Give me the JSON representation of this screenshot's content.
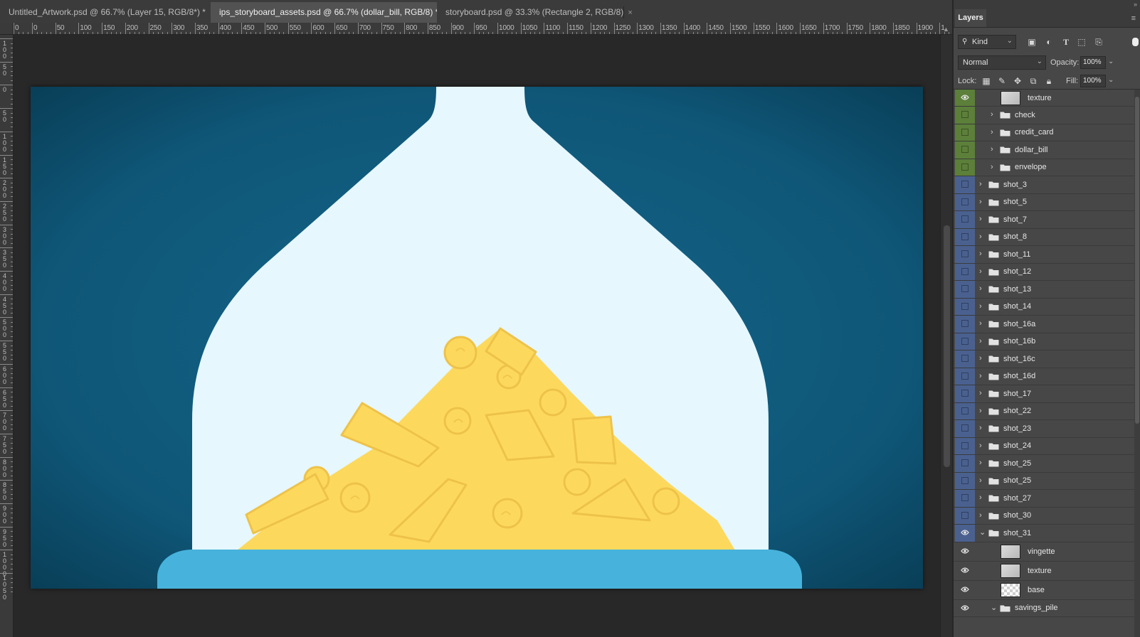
{
  "tabs": [
    {
      "label": "Untitled_Artwork.psd @ 66.7% (Layer 15, RGB/8*) *",
      "close": "×",
      "active": false
    },
    {
      "label": "ips_storyboard_assets.psd @ 66.7% (dollar_bill, RGB/8) *",
      "close": "×",
      "active": true
    },
    {
      "label": "storyboard.psd @ 33.3% (Rectangle 2, RGB/8)",
      "close": "×",
      "active": false
    }
  ],
  "ruler": {
    "h_labels": [
      "0",
      "0",
      "50",
      "100",
      "150",
      "200",
      "250",
      "300",
      "350",
      "400",
      "450",
      "500",
      "550",
      "600",
      "650",
      "700",
      "750",
      "800",
      "850",
      "900",
      "950",
      "1000",
      "1050",
      "1100",
      "1150",
      "1200",
      "1250",
      "1300",
      "1350",
      "1400",
      "1450",
      "1500",
      "1550",
      "1600",
      "1650",
      "1700",
      "1750",
      "1800",
      "1850",
      "1900",
      "1"
    ],
    "v_labels": [
      "100",
      "50",
      "0",
      "50",
      "100",
      "150",
      "200",
      "250",
      "300",
      "350",
      "400",
      "450",
      "500",
      "550",
      "600",
      "650",
      "700",
      "750",
      "800",
      "850",
      "900",
      "950",
      "1000",
      "1050"
    ]
  },
  "colors": {
    "background_blue": "#0e5677",
    "bottle": "#e6f7fd",
    "coins": "#fcd95c",
    "coin_line": "#eec24a",
    "base": "#47b3dc",
    "green_tag": "#5c7f3a",
    "blue_tag": "#4a6190"
  },
  "panel": {
    "title": "Layers",
    "collapse": "»",
    "menu": "≡",
    "filter_kind": "Kind",
    "blend_mode": "Normal",
    "opacity_label": "Opacity:",
    "opacity_value": "100%",
    "lock_label": "Lock:",
    "fill_label": "Fill:",
    "fill_value": "100%"
  },
  "layers": [
    {
      "name": "texture",
      "kind": "pixel",
      "visible": true,
      "tag": "green",
      "indent": 1
    },
    {
      "name": "check",
      "kind": "group",
      "visible": false,
      "tag": "green",
      "indent": 1,
      "expanded": false
    },
    {
      "name": "credit_card",
      "kind": "group",
      "visible": false,
      "tag": "green",
      "indent": 1,
      "expanded": false
    },
    {
      "name": "dollar_bill",
      "kind": "group",
      "visible": false,
      "tag": "green",
      "indent": 1,
      "expanded": false
    },
    {
      "name": "envelope",
      "kind": "group",
      "visible": false,
      "tag": "green",
      "indent": 1,
      "expanded": false
    },
    {
      "name": "shot_3",
      "kind": "group",
      "visible": false,
      "tag": "blue",
      "indent": 0,
      "expanded": false
    },
    {
      "name": "shot_5",
      "kind": "group",
      "visible": false,
      "tag": "blue",
      "indent": 0,
      "expanded": false
    },
    {
      "name": "shot_7",
      "kind": "group",
      "visible": false,
      "tag": "blue",
      "indent": 0,
      "expanded": false
    },
    {
      "name": "shot_8",
      "kind": "group",
      "visible": false,
      "tag": "blue",
      "indent": 0,
      "expanded": false
    },
    {
      "name": "shot_11",
      "kind": "group",
      "visible": false,
      "tag": "blue",
      "indent": 0,
      "expanded": false
    },
    {
      "name": "shot_12",
      "kind": "group",
      "visible": false,
      "tag": "blue",
      "indent": 0,
      "expanded": false
    },
    {
      "name": "shot_13",
      "kind": "group",
      "visible": false,
      "tag": "blue",
      "indent": 0,
      "expanded": false
    },
    {
      "name": "shot_14",
      "kind": "group",
      "visible": false,
      "tag": "blue",
      "indent": 0,
      "expanded": false
    },
    {
      "name": "shot_16a",
      "kind": "group",
      "visible": false,
      "tag": "blue",
      "indent": 0,
      "expanded": false
    },
    {
      "name": "shot_16b",
      "kind": "group",
      "visible": false,
      "tag": "blue",
      "indent": 0,
      "expanded": false
    },
    {
      "name": "shot_16c",
      "kind": "group",
      "visible": false,
      "tag": "blue",
      "indent": 0,
      "expanded": false
    },
    {
      "name": "shot_16d",
      "kind": "group",
      "visible": false,
      "tag": "blue",
      "indent": 0,
      "expanded": false
    },
    {
      "name": "shot_17",
      "kind": "group",
      "visible": false,
      "tag": "blue",
      "indent": 0,
      "expanded": false
    },
    {
      "name": "shot_22",
      "kind": "group",
      "visible": false,
      "tag": "blue",
      "indent": 0,
      "expanded": false
    },
    {
      "name": "shot_23",
      "kind": "group",
      "visible": false,
      "tag": "blue",
      "indent": 0,
      "expanded": false
    },
    {
      "name": "shot_24",
      "kind": "group",
      "visible": false,
      "tag": "blue",
      "indent": 0,
      "expanded": false
    },
    {
      "name": "shot_25",
      "kind": "group",
      "visible": false,
      "tag": "blue",
      "indent": 0,
      "expanded": false
    },
    {
      "name": "shot_25",
      "kind": "group",
      "visible": false,
      "tag": "blue",
      "indent": 0,
      "expanded": false
    },
    {
      "name": "shot_27",
      "kind": "group",
      "visible": false,
      "tag": "blue",
      "indent": 0,
      "expanded": false
    },
    {
      "name": "shot_30",
      "kind": "group",
      "visible": false,
      "tag": "blue",
      "indent": 0,
      "expanded": false
    },
    {
      "name": "shot_31",
      "kind": "group",
      "visible": true,
      "tag": "blue",
      "indent": 0,
      "expanded": true
    },
    {
      "name": "vingette",
      "kind": "pixel",
      "visible": true,
      "tag": "none",
      "indent": 1
    },
    {
      "name": "texture",
      "kind": "pixel",
      "visible": true,
      "tag": "none",
      "indent": 1
    },
    {
      "name": "base",
      "kind": "shape",
      "visible": true,
      "tag": "none",
      "indent": 1
    },
    {
      "name": "savings_pile",
      "kind": "group",
      "visible": true,
      "tag": "none",
      "indent": 1,
      "expanded": true
    }
  ]
}
